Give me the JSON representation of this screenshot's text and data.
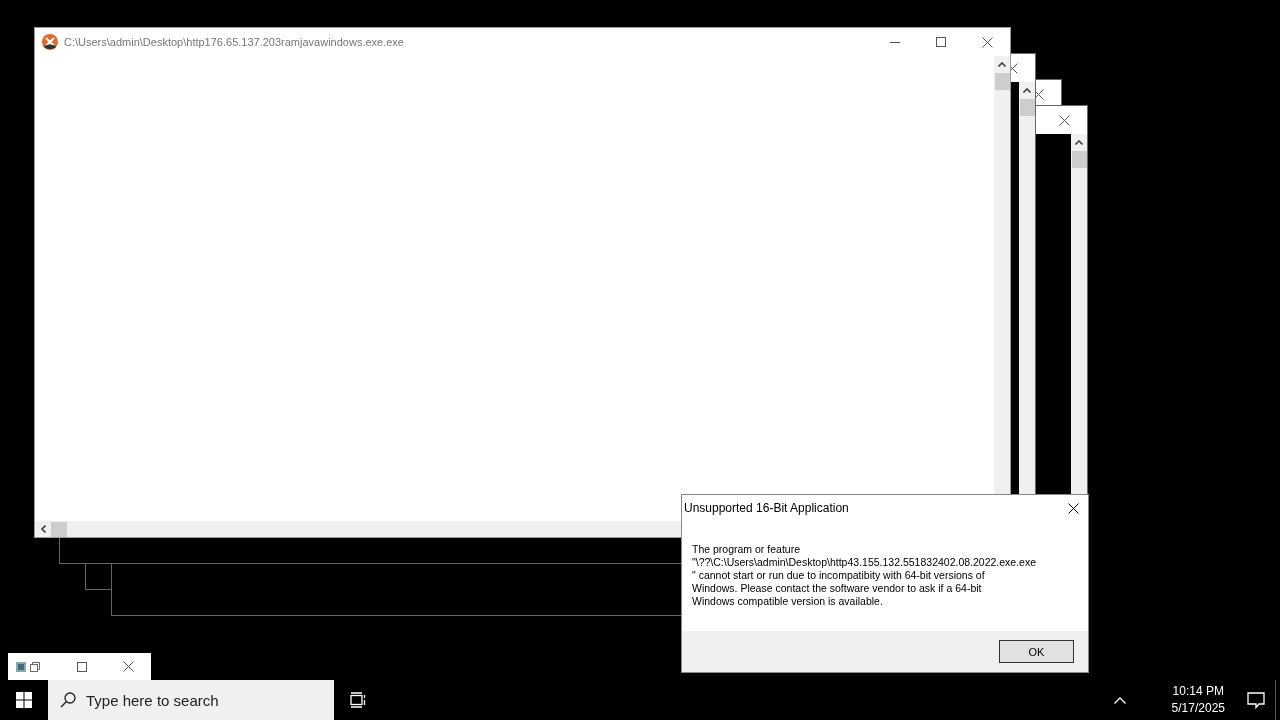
{
  "main_window": {
    "title": "C:\\Users\\admin\\Desktop\\http176.65.137.203ramjavawindows.exe.exe"
  },
  "dialog": {
    "title": "Unsupported 16-Bit Application",
    "message": [
      "The program or feature",
      "\"\\??\\C:\\Users\\admin\\Desktop\\http43.155.132.551832402.08.2022.exe.exe",
      "\" cannot start or run due to incompatibity with 64-bit versions of",
      "Windows. Please contact the software vendor to ask if a 64-bit",
      "Windows compatible version is available."
    ],
    "buttons": [
      "OK"
    ]
  },
  "taskbar": {
    "search": {
      "placeholder": "Type here to search"
    },
    "clock": {
      "time": "10:14 PM",
      "date": "5/17/2025"
    }
  }
}
